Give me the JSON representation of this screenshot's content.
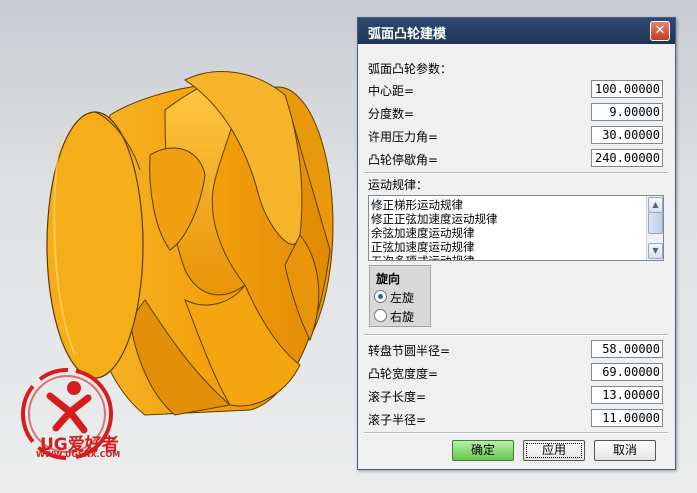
{
  "dialog": {
    "title": "弧面凸轮建模",
    "close_icon": "close-icon",
    "params_heading": "弧面凸轮参数：",
    "params": [
      {
        "label": "中心距=",
        "value": "100.00000"
      },
      {
        "label": "分度数=",
        "value": "9.00000"
      },
      {
        "label": "许用压力角=",
        "value": "30.00000"
      },
      {
        "label": "凸轮停歇角=",
        "value": "240.00000"
      }
    ],
    "motion_heading": "运动规律：",
    "motion_items": [
      "修正梯形运动规律",
      "修正正弦加速度运动规律",
      "余弦加速度运动规律",
      "正弦加速度运动规律",
      "五次多项式运动规律"
    ],
    "rotation": {
      "title": "旋向",
      "options": [
        "左旋",
        "右旋"
      ],
      "selected": "左旋"
    },
    "params2": [
      {
        "label": "转盘节圆半径=",
        "value": "58.00000"
      },
      {
        "label": "凸轮宽度度=",
        "value": "69.00000"
      },
      {
        "label": "滚子长度=",
        "value": "13.00000"
      },
      {
        "label": "滚子半径=",
        "value": "11.00000"
      }
    ],
    "buttons": {
      "ok": "确定",
      "apply": "应用",
      "cancel": "取消"
    }
  },
  "watermark": {
    "brand": "UG爱好者",
    "url": "WWW.UGSNX.COM"
  },
  "colors": {
    "cam_orange": "#f3a60f",
    "ok_green": "#67c64f",
    "title_bar": "#2e4870",
    "logo_red": "#d41e1e"
  }
}
